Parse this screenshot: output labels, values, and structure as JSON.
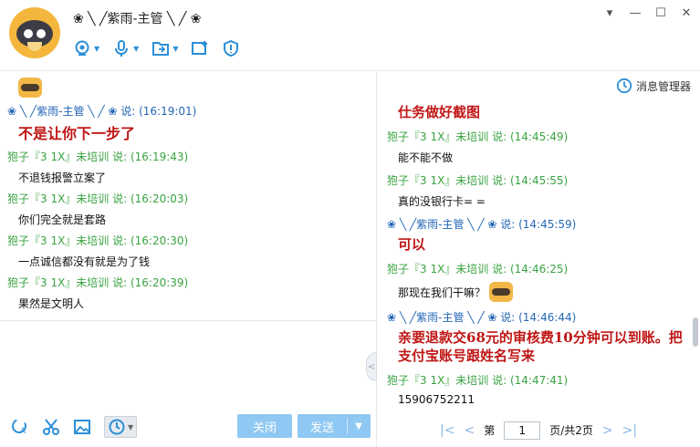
{
  "header": {
    "contact_name": "❀ ╲ ╱紫雨-主管 ╲ ╱ ❀",
    "tools": [
      "camera-icon",
      "microphone-icon",
      "file-transfer-icon",
      "screen-share-icon",
      "shield-icon"
    ],
    "window_buttons": {
      "menu": "▾",
      "minimize": "—",
      "maximize": "☐",
      "close": "✕"
    }
  },
  "left_chat": {
    "messages": [
      {
        "sender": "❀ ╲ ╱紫雨-主管 ╲ ╱ ❀ 说: (16:19:01)",
        "text": "不是让你下一步了",
        "sender_color": "blue",
        "emphasis": true
      },
      {
        "sender": "狍子『3 1X』未培训 说: (16:19:43)",
        "text": "不退钱报警立案了",
        "sender_color": "green"
      },
      {
        "sender": "狍子『3 1X』未培训 说: (16:20:03)",
        "text": "你们完全就是套路",
        "sender_color": "green"
      },
      {
        "sender": "狍子『3 1X』未培训 说: (16:20:30)",
        "text": "一点诚信都没有就是为了钱",
        "sender_color": "green"
      },
      {
        "sender": "狍子『3 1X』未培训 说: (16:20:39)",
        "text": "果然是文明人",
        "sender_color": "green"
      }
    ]
  },
  "input_area": {
    "tools": [
      "font-icon",
      "scissors-icon",
      "image-icon",
      "history-clock-icon"
    ],
    "close_label": "关闭",
    "send_label": "发送"
  },
  "right_history": {
    "manager_label": "消息管理器",
    "messages": [
      {
        "sender": "",
        "text": "仕务做好截图",
        "emphasis": true
      },
      {
        "sender": "狍子『3 1X』未培训 说: (14:45:49)",
        "text": "能不能不做",
        "sender_color": "green"
      },
      {
        "sender": "狍子『3 1X』未培训 说: (14:45:55)",
        "text": "真的没银行卡= =",
        "sender_color": "green"
      },
      {
        "sender": "❀ ╲ ╱紫雨-主管 ╲ ╱ ❀ 说: (14:45:59)",
        "text": "可以",
        "sender_color": "blue",
        "emphasis": true
      },
      {
        "sender": "狍子『3 1X』未培训 说: (14:46:25)",
        "text": "那现在我们干嘛？",
        "sender_color": "green",
        "sticker": true
      },
      {
        "sender": "❀ ╲ ╱紫雨-主管 ╲ ╱ ❀ 说: (14:46:44)",
        "text": "亲要退款交68元的审核费10分钟可以到账。把支付宝账号跟姓名写来",
        "sender_color": "blue",
        "emphasis": true
      },
      {
        "sender": "狍子『3 1X』未培训 说: (14:47:41)",
        "text": "15906752211",
        "sender_color": "green"
      }
    ]
  },
  "pager": {
    "first": "|<",
    "prev": "<",
    "page_prefix": "第",
    "page_value": "1",
    "page_suffix": "页/共2页",
    "next": ">",
    "last": ">|"
  }
}
